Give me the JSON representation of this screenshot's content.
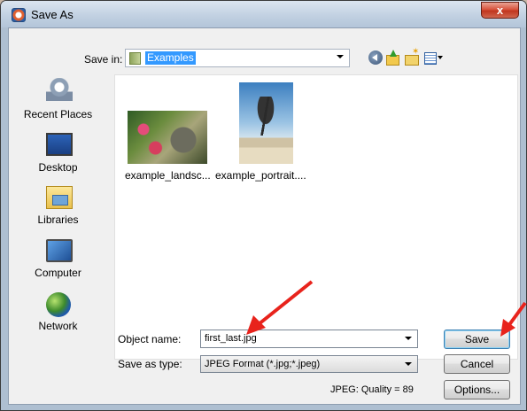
{
  "window": {
    "title": "Save As",
    "close_glyph": "x"
  },
  "toolbar": {
    "save_in_label": "Save in:",
    "save_in_value": "Examples",
    "icons": [
      "back-icon",
      "up-folder-icon",
      "new-folder-icon",
      "view-menu-icon"
    ]
  },
  "places": [
    {
      "label": "Recent Places",
      "icon": "recent-places-icon"
    },
    {
      "label": "Desktop",
      "icon": "desktop-icon"
    },
    {
      "label": "Libraries",
      "icon": "libraries-icon"
    },
    {
      "label": "Computer",
      "icon": "computer-icon"
    },
    {
      "label": "Network",
      "icon": "network-icon"
    }
  ],
  "files": [
    {
      "name": "example_landsc..."
    },
    {
      "name": "example_portrait...."
    }
  ],
  "form": {
    "object_name_label": "Object name:",
    "object_name_value": "first_last.jpg",
    "save_as_type_label": "Save as type:",
    "save_as_type_value": "JPEG Format (*.jpg;*.jpeg)",
    "quality_text": "JPEG: Quality = 89"
  },
  "buttons": {
    "save": "Save",
    "cancel": "Cancel",
    "options": "Options..."
  },
  "colors": {
    "selection": "#3399ff",
    "annotation_arrow": "#e8231c",
    "close_button": "#c1361f"
  }
}
